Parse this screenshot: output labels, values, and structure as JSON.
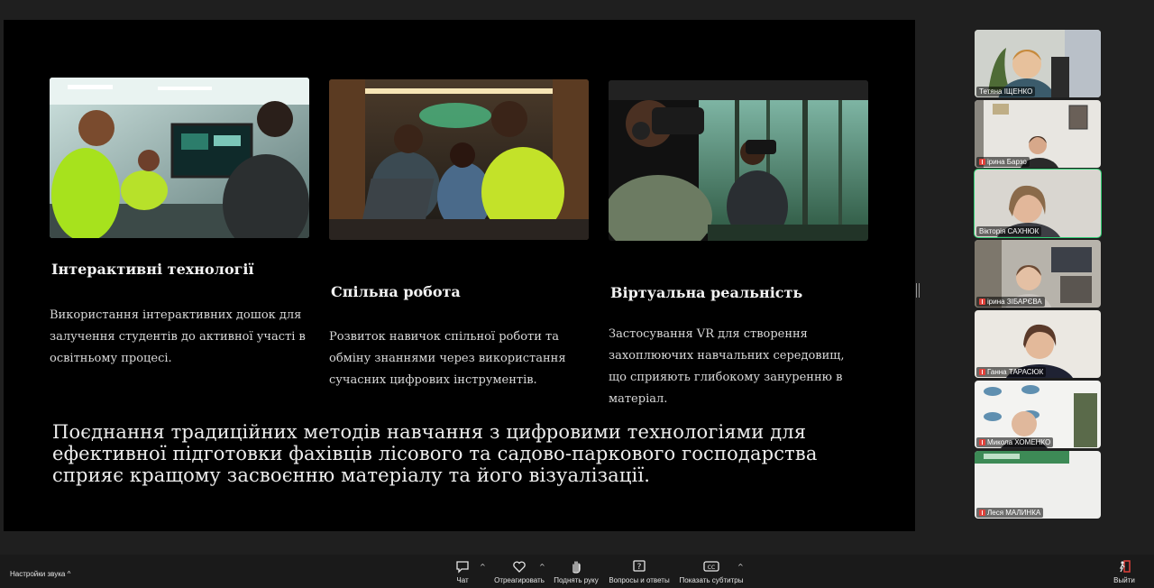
{
  "slide": {
    "cards": [
      {
        "title": "Інтерактивні технології",
        "text": "Використання інтерактивних дошок для залучення студентів до активної участі в освітньому процесі.",
        "image": "classroom-interactive-board-photo"
      },
      {
        "title": "Спільна робота",
        "text": "Розвиток навичок спільної роботи та обміну знаннями через використання сучасних цифрових інструментів.",
        "image": "students-laptops-library-photo"
      },
      {
        "title": "Віртуальна реальність",
        "text": "Застосування VR для створення захоплюючих навчальних середовищ, що сприяють глибокому зануренню в матеріал.",
        "image": "vr-headset-forest-photo"
      }
    ],
    "summary": "Поєднання традиційних методів навчання з цифровими технологіями для ефективної підготовки фахівців лісового та садово-паркового господарства сприяє кращому засвоєнню матеріалу та його візуалізації."
  },
  "participants": [
    {
      "name": "Тетяна ІЩЕНКО",
      "muted": false
    },
    {
      "name": "ірина Барзо",
      "muted": true
    },
    {
      "name": "Вікторія САХНЮК",
      "muted": false,
      "active": true
    },
    {
      "name": "ірина ЗІБАРЄВА",
      "muted": true
    },
    {
      "name": "Ганна ТАРАСЮК",
      "muted": true
    },
    {
      "name": "Микола ХОМЕНКО",
      "muted": true
    },
    {
      "name": "Леся МАЛИНКА",
      "muted": true
    }
  ],
  "toolbar": {
    "audio_settings": "Настройки звука",
    "chat": "Чат",
    "react": "Отреагировать",
    "raise_hand": "Поднять руку",
    "qa": "Вопросы и ответы",
    "captions": "Показать субтитры",
    "leave": "Выйти"
  },
  "colors": {
    "active_speaker": "#2ecc71",
    "leave_icon": "#e0413a",
    "neon_green": "#9be31f"
  }
}
